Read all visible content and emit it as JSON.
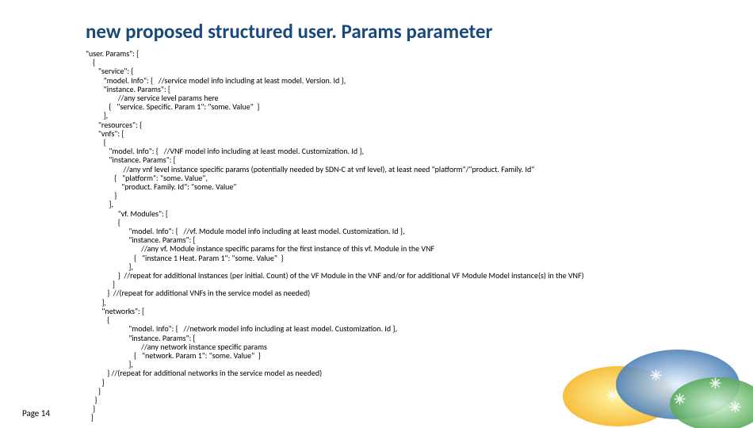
{
  "title": "new proposed structured user. Params parameter",
  "pageLabel": "Page 14",
  "code": {
    "l01": "\"user. Params\": [",
    "l02": "    {",
    "l03": "       \"service\": {",
    "l04": "          \"model. Info\": {   //service model info including at least model. Version. Id },",
    "l05": "          \"instance. Params\": [",
    "l06": "                  //any service level params here",
    "l07": "             {   \"service. Specific. Param 1\": \"some. Value\"  }",
    "l08": "          ],",
    "l09": "       \"resources\": {",
    "l10": "       \"vnfs\": [",
    "l11": "          {",
    "l12": "             \"model. Info\": {   //VNF model info including at least model. Customization. Id },",
    "l13": "             \"instance. Params\": [",
    "l14": "                     //any vnf level instance specific params (potentially needed by SDN-C at vnf level), at least need \"platform\"/\"product. Family. Id\"",
    "l15": "                {   \"platform\": \"some. Value\",",
    "l16": "                    \"product. Family. Id\": \"some. Value\"",
    "l17": "                }",
    "l18": "             ],",
    "l19": "                  \"vf. Modules\": [",
    "l20": "                  {",
    "l21": "                        \"model. Info\": {   //vf. Module model info including at least model. Customization. Id },",
    "l22": "                        \"instance. Params\": [",
    "l23": "                               //any vf. Module instance specific params for the first instance of this vf. Module in the VNF",
    "l24": "                           {   \"instance 1 Heat. Param 1\": \"some. Value\"  }",
    "l25": "                        ],",
    "l26": "                  }  //repeat for additional instances (per initial. Count) of the VF Module in the VNF and/or for additional VF Module Model instance(s) in the VNF)",
    "l27": "               ]",
    "l28": "            }  //(repeat for additional VNFs in the service model as needed)",
    "l29": "         ],",
    "l30": "         \"networks\": [",
    "l31": "            {",
    "l32": "                        \"model. Info\": {   //network model info including at least model. Customization. Id },",
    "l33": "                        \"instance. Params\": [",
    "l34": "                               //any network instance specific params",
    "l35": "                           {   \"network. Param 1\": \"some. Value\"  }",
    "l36": "                        ],",
    "l37": "            } //(repeat for additional networks in the service model as needed)",
    "l38": "         ]",
    "l39": "       }",
    "l40": "     }",
    "l41": "    }",
    "l42": "   ]"
  }
}
